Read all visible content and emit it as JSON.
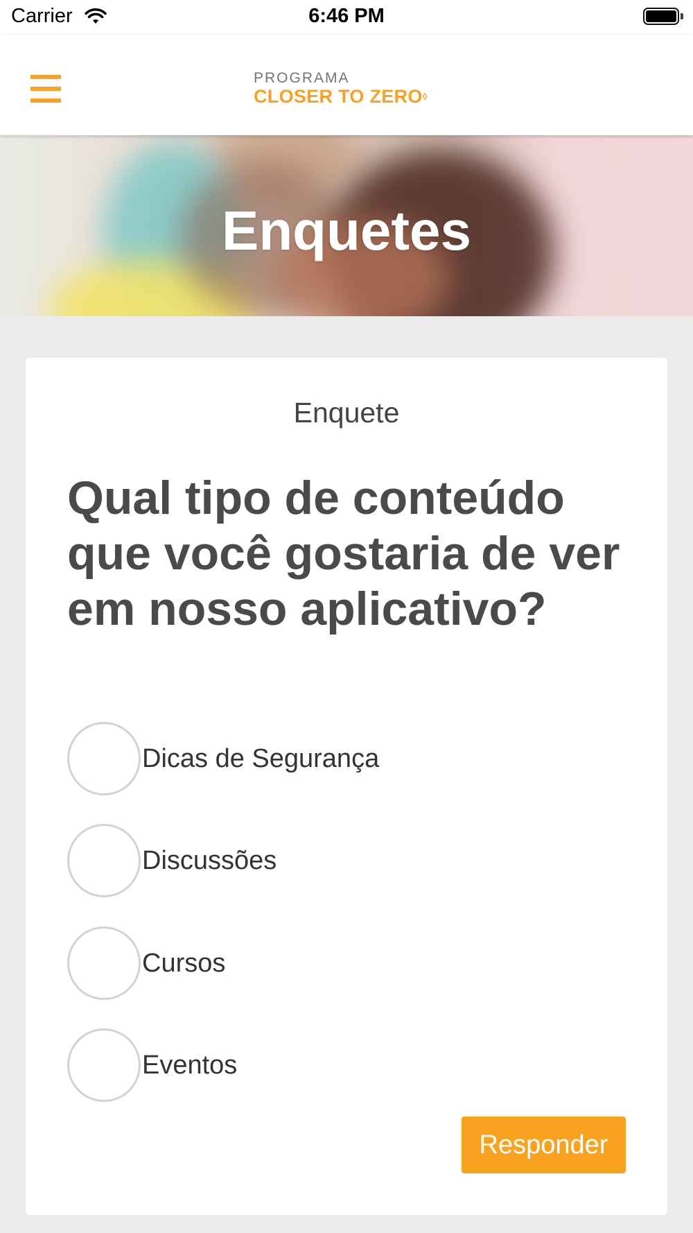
{
  "status_bar": {
    "carrier": "Carrier",
    "time": "6:46 PM",
    "wifi_icon": "wifi-icon",
    "battery_icon": "battery-icon"
  },
  "header": {
    "menu_icon": "hamburger-menu-icon",
    "logo_top": "PROGRAMA",
    "logo_main": "CLOSER TO ZERO",
    "accent_color": "#f7a126"
  },
  "banner": {
    "title": "Enquetes"
  },
  "poll": {
    "label": "Enquete",
    "question": "Qual tipo de conteúdo que você gostaria de ver em nosso aplicativo?",
    "options": [
      {
        "label": "Dicas de Segurança",
        "selected": false
      },
      {
        "label": "Discussões",
        "selected": false
      },
      {
        "label": "Cursos",
        "selected": false
      },
      {
        "label": "Eventos",
        "selected": false
      }
    ],
    "submit_label": "Responder",
    "button_color": "#f9a21f"
  }
}
